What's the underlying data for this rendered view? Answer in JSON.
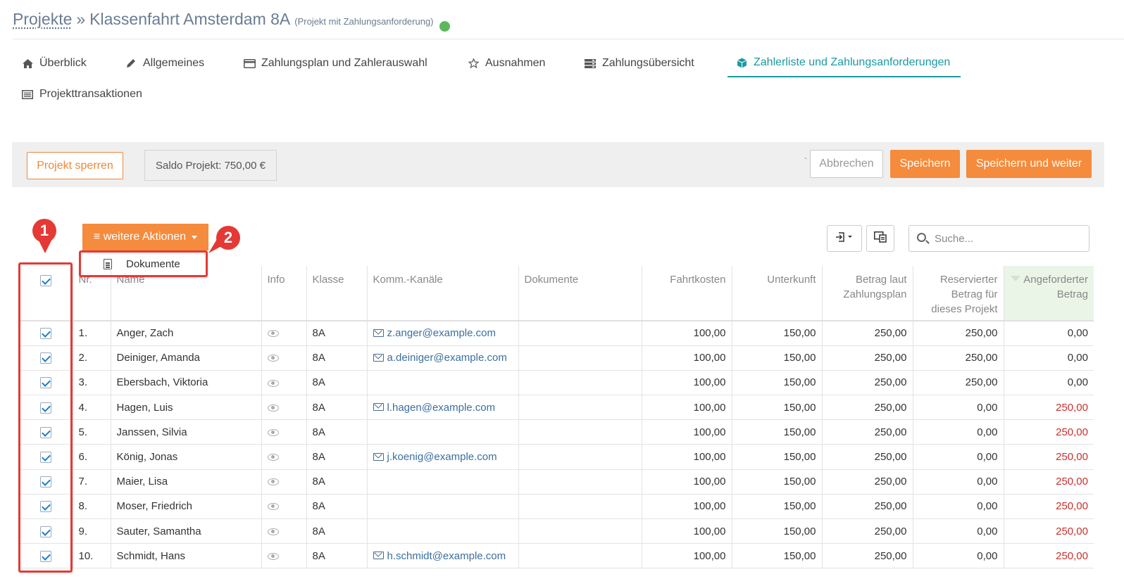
{
  "header": {
    "breadcrumb_link": "Projekte",
    "separator": "»",
    "project_title": "Klassenfahrt Amsterdam 8A",
    "project_subtitle": "(Projekt mit Zahlungsanforderung)",
    "status_color": "#5cb85c"
  },
  "tabs": [
    {
      "label": "Überblick",
      "icon": "home-icon"
    },
    {
      "label": "Allgemeines",
      "icon": "pencil-icon"
    },
    {
      "label": "Zahlungsplan und Zahlerauswahl",
      "icon": "credit-card-icon"
    },
    {
      "label": "Ausnahmen",
      "icon": "star-icon"
    },
    {
      "label": "Zahlungsübersicht",
      "icon": "server-icon"
    },
    {
      "label": "Zahlerliste und Zahlungsanforderungen",
      "icon": "cube-icon",
      "active": true
    },
    {
      "label": "Projekttransaktionen",
      "icon": "list-alt-icon"
    }
  ],
  "toolbar": {
    "lock_label": "Projekt sperren",
    "saldo_label": "Saldo Projekt: 750,00 €",
    "tick": "`",
    "cancel_label": "Abbrechen",
    "save_label": "Speichern",
    "save_next_label": "Speichern und weiter"
  },
  "list_actions": {
    "more_actions_label": "≡ weitere Aktionen",
    "dropdown_item": "Dokumente",
    "search_placeholder": "Suche..."
  },
  "annotations": {
    "marker_1": "1",
    "marker_2": "2",
    "highlight_color": "#e53935"
  },
  "table": {
    "columns": [
      "Nr.",
      "Name",
      "Info",
      "Klasse",
      "Komm.-Kanäle",
      "Dokumente",
      "Fahrtkosten",
      "Unterkunft",
      "Betrag laut Zahlungsplan",
      "Reservierter Betrag für dieses Projekt",
      "Angeforderter Betrag"
    ],
    "rows": [
      {
        "nr": "1.",
        "name": "Anger, Zach",
        "klasse": "8A",
        "email": "z.anger@example.com",
        "fahrt": "100,00",
        "unterkunft": "150,00",
        "plan": "250,00",
        "reserviert": "250,00",
        "angefordert": "0,00"
      },
      {
        "nr": "2.",
        "name": "Deiniger, Amanda",
        "klasse": "8A",
        "email": "a.deiniger@example.com",
        "fahrt": "100,00",
        "unterkunft": "150,00",
        "plan": "250,00",
        "reserviert": "250,00",
        "angefordert": "0,00"
      },
      {
        "nr": "3.",
        "name": "Ebersbach, Viktoria",
        "klasse": "8A",
        "email": "",
        "fahrt": "100,00",
        "unterkunft": "150,00",
        "plan": "250,00",
        "reserviert": "250,00",
        "angefordert": "0,00"
      },
      {
        "nr": "4.",
        "name": "Hagen, Luis",
        "klasse": "8A",
        "email": "l.hagen@example.com",
        "fahrt": "100,00",
        "unterkunft": "150,00",
        "plan": "250,00",
        "reserviert": "0,00",
        "angefordert": "250,00"
      },
      {
        "nr": "5.",
        "name": "Janssen, Silvia",
        "klasse": "8A",
        "email": "",
        "fahrt": "100,00",
        "unterkunft": "150,00",
        "plan": "250,00",
        "reserviert": "0,00",
        "angefordert": "250,00"
      },
      {
        "nr": "6.",
        "name": "König, Jonas",
        "klasse": "8A",
        "email": "j.koenig@example.com",
        "fahrt": "100,00",
        "unterkunft": "150,00",
        "plan": "250,00",
        "reserviert": "0,00",
        "angefordert": "250,00"
      },
      {
        "nr": "7.",
        "name": "Maier, Lisa",
        "klasse": "8A",
        "email": "",
        "fahrt": "100,00",
        "unterkunft": "150,00",
        "plan": "250,00",
        "reserviert": "0,00",
        "angefordert": "250,00"
      },
      {
        "nr": "8.",
        "name": "Moser, Friedrich",
        "klasse": "8A",
        "email": "",
        "fahrt": "100,00",
        "unterkunft": "150,00",
        "plan": "250,00",
        "reserviert": "0,00",
        "angefordert": "250,00"
      },
      {
        "nr": "9.",
        "name": "Sauter, Samantha",
        "klasse": "8A",
        "email": "",
        "fahrt": "100,00",
        "unterkunft": "150,00",
        "plan": "250,00",
        "reserviert": "0,00",
        "angefordert": "250,00"
      },
      {
        "nr": "10.",
        "name": "Schmidt, Hans",
        "klasse": "8A",
        "email": "h.schmidt@example.com",
        "fahrt": "100,00",
        "unterkunft": "150,00",
        "plan": "250,00",
        "reserviert": "0,00",
        "angefordert": "250,00"
      }
    ]
  }
}
